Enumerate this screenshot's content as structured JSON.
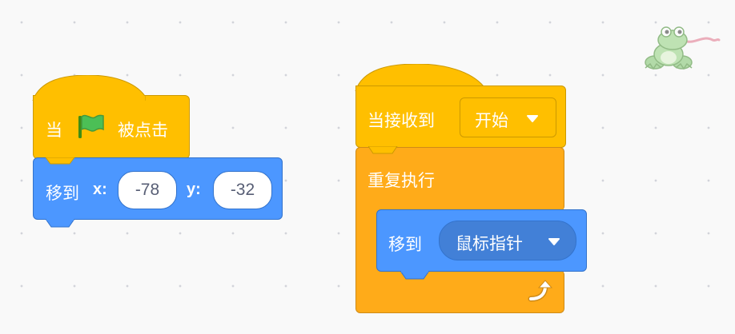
{
  "script1": {
    "hat": {
      "prefix": "当",
      "flag_icon": "green-flag-icon",
      "suffix": "被点击"
    },
    "goto_xy": {
      "label": "移到",
      "x_label": "x:",
      "x_value": "-78",
      "y_label": "y:",
      "y_value": "-32"
    }
  },
  "script2": {
    "hat": {
      "label": "当接收到",
      "message": "开始"
    },
    "repeat": {
      "label": "重复执行",
      "loop_icon": "loop-arrow-icon"
    },
    "goto_target": {
      "label": "移到",
      "target": "鼠标指针"
    }
  },
  "sprite_icon": "frog-sprite-icon",
  "colors": {
    "events": "#ffbf00",
    "motion": "#4c97ff",
    "control": "#ffab19",
    "canvas": "#f9f9f9"
  }
}
